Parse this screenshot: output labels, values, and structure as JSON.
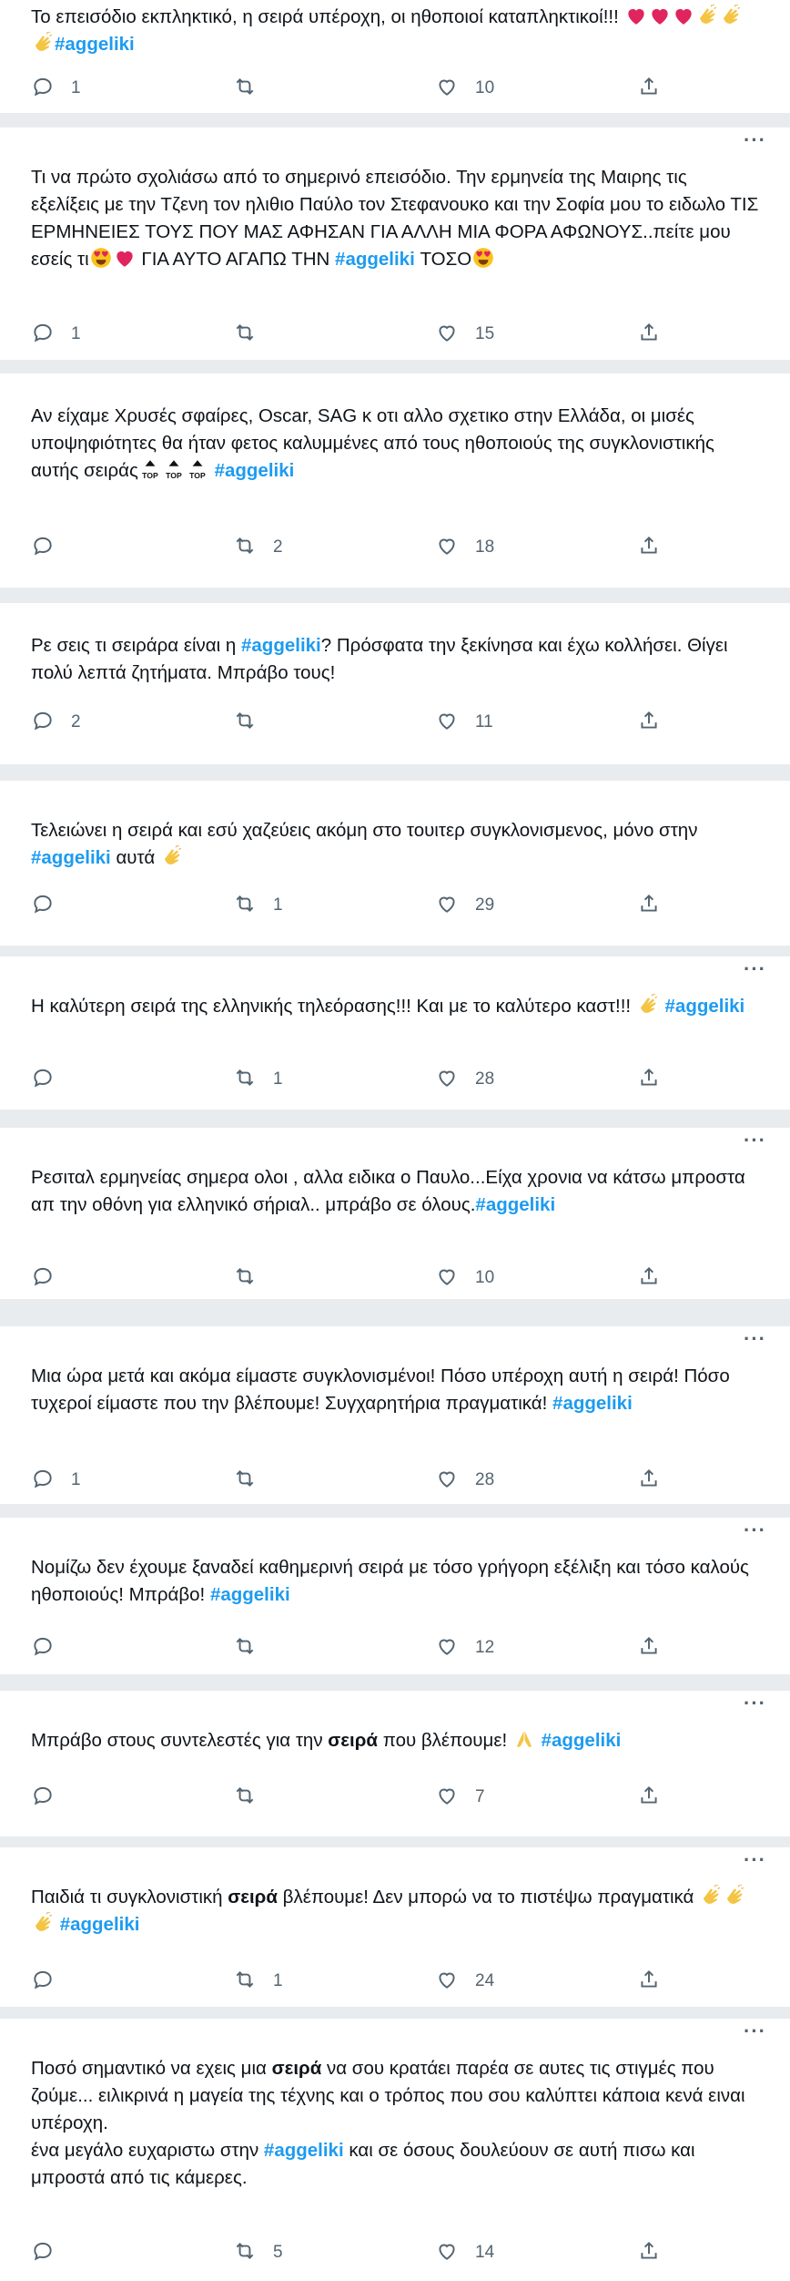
{
  "tweets": [
    {
      "text": "Το επεισόδιο εκπληκτικό, η σειρά υπέροχη, οι ηθοποιοί καταπληκτικοί!!! ❤❤❤👏👏👏#aggeliki",
      "replies": "1",
      "retweets": "",
      "likes": "10"
    },
    {
      "text": "Τι να πρώτο σχολιάσω από το σημερινό επεισόδιο. Την ερμηνεία της Μαιρης τις εξελίξεις με την Τζενη τον ηλιθιο Παύλο τον Στεφανουκο και την Σοφία μου το ειδωλο ΤΙΣ ΕΡΜΗΝΕΙΕΣ ΤΟΥΣ ΠΟΥ ΜΑΣ ΑΦΗΣΑΝ ΓΙΑ ΑΛΛΗ ΜΙΑ ΦΟΡΑ ΑΦΩΝΟΥΣ..πείτε μου εσείς τι😍❤ ΓΙΑ ΑΥΤΟ ΑΓΑΠΩ ΤΗΝ #aggeliki ΤΟΣΟ😍",
      "replies": "1",
      "retweets": "",
      "likes": "15"
    },
    {
      "text": "Αν είχαμε Χρυσές σφαίρες,  Oscar, SAG κ οτι αλλο σχετικο στην Ελλάδα,  οι μισές υποψηφιότητες θα ήταν φετος καλυμμένες από τους ηθοποιούς της συγκλονιστικής αυτής σειράς🔝🔝🔝 #aggeliki",
      "replies": "",
      "retweets": "2",
      "likes": "18"
    },
    {
      "text": "Ρε σεις τι σειράρα είναι η #aggeliki? Πρόσφατα την ξεκίνησα και έχω κολλήσει. Θίγει πολύ λεπτά ζητήματα. Μπράβο τους!",
      "replies": "2",
      "retweets": "",
      "likes": "11"
    },
    {
      "text": "Τελειώνει η σειρά και εσύ χαζεύεις ακόμη στο τουιτερ συγκλονισμενος, μόνο στην #aggeliki αυτά 👏",
      "replies": "",
      "retweets": "1",
      "likes": "29"
    },
    {
      "text": "Η καλύτερη σειρά της ελληνικής τηλεόρασης!!! Και με το καλύτερο καστ!!! 👏 #aggeliki",
      "replies": "",
      "retweets": "1",
      "likes": "28"
    },
    {
      "text": "Ρεσιταλ ερμηνείας σημερα ολοι , αλλα ειδικα ο  Παυλο...Είχα χρονια να κάτσω μπροστα απ την οθόνη για ελληνικό σήριαλ.. μπράβο σε όλους.#aggeliki",
      "replies": "",
      "retweets": "",
      "likes": "10"
    },
    {
      "text": "Μια ώρα μετά και ακόμα είμαστε συγκλονισμένοι! Πόσο υπέροχη αυτή η σειρά! Πόσο τυχεροί είμαστε που την βλέπουμε! Συγχαρητήρια πραγματικά! #aggeliki",
      "replies": "1",
      "retweets": "",
      "likes": "28"
    },
    {
      "text": "Νομίζω δεν έχουμε ξαναδεί καθημερινή σειρά με τόσο γρήγορη εξέλιξη και τόσο καλούς ηθοποιούς! Μπράβο! #aggeliki",
      "replies": "",
      "retweets": "",
      "likes": "12"
    },
    {
      "text": "Μπράβο στους συντελεστές για την σειρά που βλέπουμε! 🙏 #aggeliki",
      "replies": "",
      "retweets": "",
      "likes": "7"
    },
    {
      "text": "Παιδιά τι συγκλονιστική σειρά βλέπουμε! Δεν μπορώ να το πιστέψω πραγματικά 👏👏👏 #aggeliki",
      "replies": "",
      "retweets": "1",
      "likes": "24"
    },
    {
      "text": "Ποσό σημαντικό να εχεις μια σειρά να σου κρατάει παρέα σε αυτες τις στιγμές που ζούμε... ειλικρινά η μαγεία της τέχνης και ο τρόπος που σου καλύπτει κάποια κενά ειναι υπέροχη.\nένα μεγάλο ευχαριστω στην #aggeliki και σε όσους δουλεύουν σε αυτή πισω και μπροστά από τις κάμερες.",
      "replies": "",
      "retweets": "5",
      "likes": "14"
    }
  ],
  "icons": {
    "reply": "reply-icon",
    "retweet": "retweet-icon",
    "like": "heart-icon",
    "share": "share-icon",
    "more": "more-icon"
  },
  "colors": {
    "hashtag": "#1d9bf0",
    "muted": "#536471",
    "separator": "#e8ecef",
    "heart": "#e0245e",
    "clap": "#f4c542"
  }
}
